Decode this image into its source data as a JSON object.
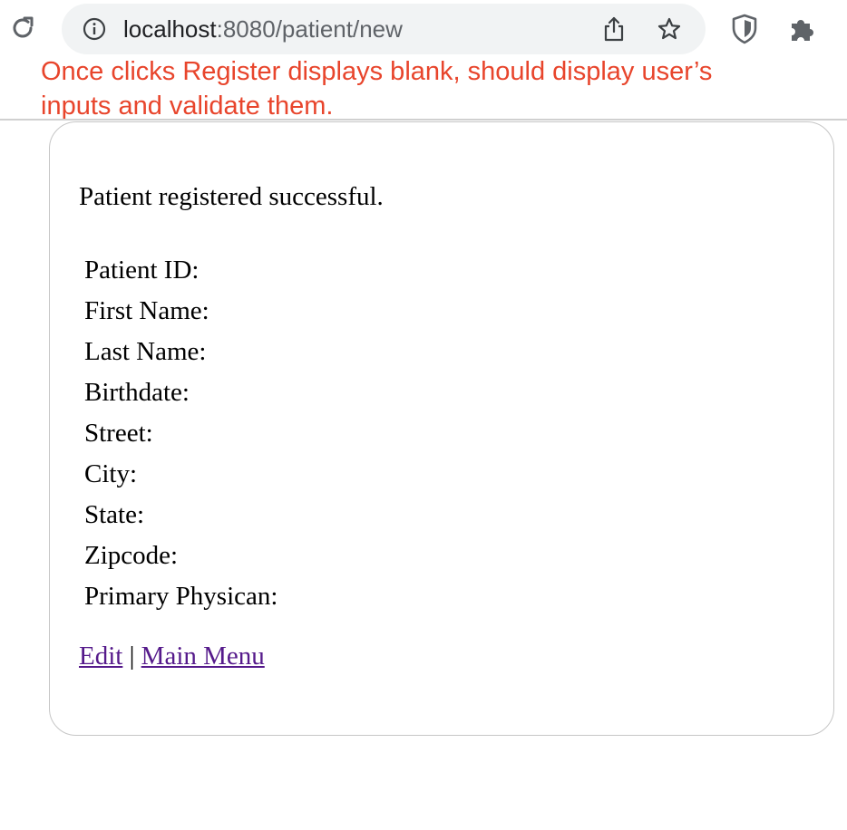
{
  "browser": {
    "url_host": "localhost",
    "url_path": ":8080/patient/new",
    "icons": [
      "reload-icon",
      "info-icon",
      "share-icon",
      "star-icon",
      "shield-icon",
      "puzzle-icon"
    ]
  },
  "annotation": {
    "text": "Once clicks Register displays blank, should display user’s inputs and validate them.",
    "color": "#e8452c"
  },
  "card": {
    "message": "Patient registered successful.",
    "fields": [
      "Patient ID:",
      "First Name:",
      "Last Name:",
      "Birthdate:",
      "Street:",
      "City:",
      "State:",
      "Zipcode:",
      "Primary Physican:"
    ],
    "links": {
      "edit": "Edit",
      "separator": "|",
      "main_menu": "Main Menu"
    },
    "link_color": "#551a8b"
  }
}
